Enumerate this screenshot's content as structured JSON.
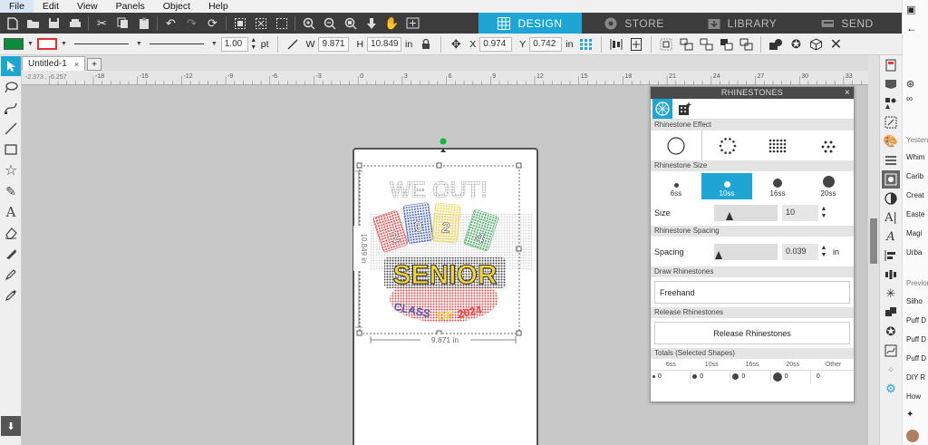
{
  "menu": {
    "file": "File",
    "edit": "Edit",
    "view": "View",
    "panels": "Panels",
    "object": "Object",
    "help": "Help"
  },
  "main_tabs": {
    "design": "DESIGN",
    "store": "STORE",
    "library": "LIBRARY",
    "send": "SEND"
  },
  "toolbar2": {
    "fill_color": "#0a8c3c",
    "line_color": "#e03030",
    "line_width": "1.00",
    "line_unit": "pt",
    "w_label": "W",
    "w_value": "9.871",
    "h_label": "H",
    "h_value": "10.849",
    "size_unit": "in",
    "x_label": "X",
    "x_value": "0.974",
    "y_label": "Y",
    "y_value": "0.742"
  },
  "document": {
    "tab_label": "Untitled-1",
    "close": "×",
    "add": "+"
  },
  "ruler": {
    "coords": "-2.373 , -6.257",
    "ticks": [
      "-18",
      "-15",
      "-12",
      "-9",
      "-6",
      "-3",
      "0",
      "3",
      "6",
      "9",
      "12",
      "15",
      "18",
      "21",
      "24",
      "27",
      "30",
      "33"
    ]
  },
  "design": {
    "line1": "WE OUT!",
    "year_digits": [
      "2",
      "0",
      "2",
      "4"
    ],
    "line2": "SENIOR",
    "line3_a": "CLASS",
    "line3_b": "OF",
    "line3_c": "2024",
    "width_dim": "9.871 in",
    "height_dim": "10.849 in"
  },
  "rhinestones": {
    "title": "RHINESTONES",
    "close": "×",
    "effect_section": "Rhinestone Effect",
    "size_section": "Rhinestone Size",
    "sizes": [
      "6ss",
      "10ss",
      "16ss",
      "20ss"
    ],
    "size_label": "Size",
    "size_value": "10",
    "spacing_section": "Rhinestone Spacing",
    "spacing_label": "Spacing",
    "spacing_value": "0.039",
    "spacing_unit": "in",
    "draw_section": "Draw Rhinestones",
    "freehand": "Freehand",
    "release_section": "Release Rhinestones",
    "release_button": "Release Rhinestones",
    "totals_section": "Totals (Selected Shapes)",
    "totals_headers": [
      "6ss",
      "10ss",
      "16ss",
      "20ss",
      "Other"
    ],
    "totals_values": [
      "0",
      "0",
      "0",
      "0",
      "0"
    ]
  },
  "browser_panel": {
    "section1": "Yesterday",
    "items1": [
      "Whim",
      "Carib",
      "Creat",
      "Easte",
      "Magi",
      "Urba"
    ],
    "section2": "Previous",
    "items2": [
      "Silho",
      "Puff D",
      "Puff D",
      "Puff D",
      "DIY R",
      "How"
    ]
  }
}
